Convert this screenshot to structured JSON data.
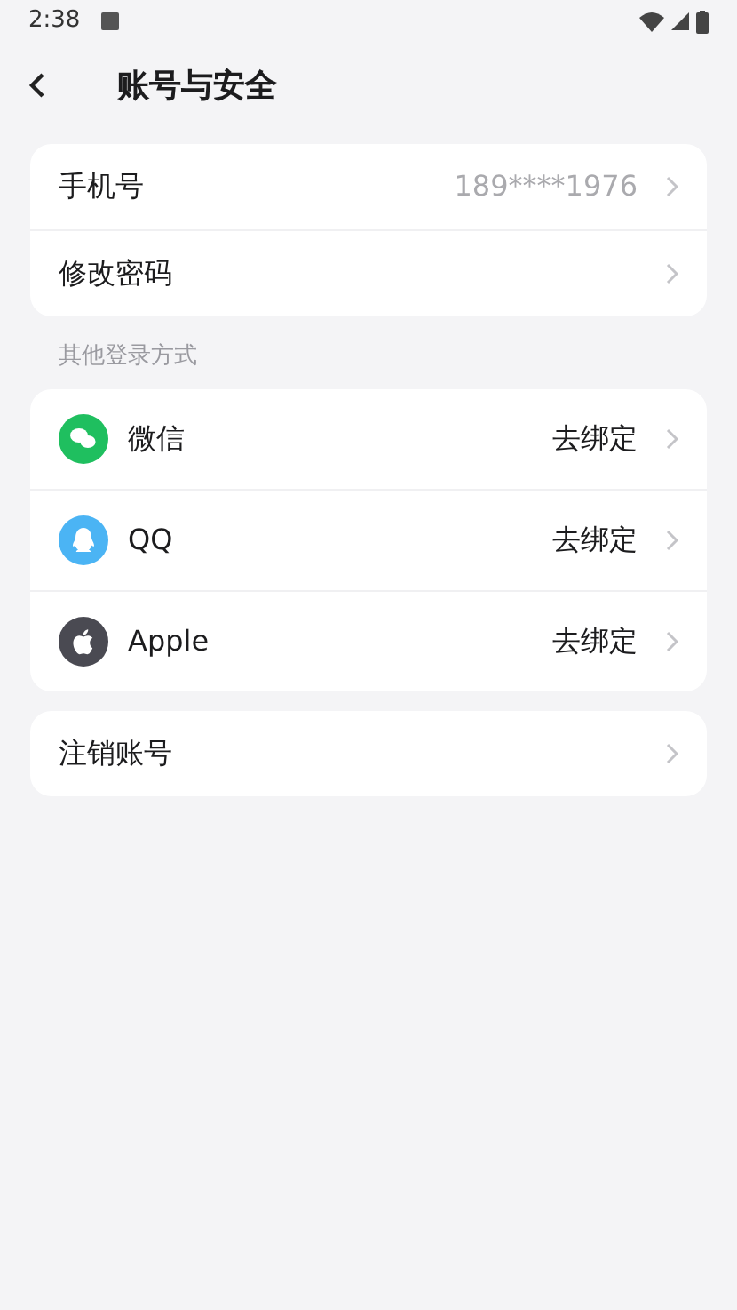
{
  "status_bar": {
    "time": "2:38"
  },
  "header": {
    "title": "账号与安全"
  },
  "account_items": [
    {
      "label": "手机号",
      "value": "189****1976"
    },
    {
      "label": "修改密码"
    }
  ],
  "section_label": "其他登录方式",
  "login_methods": [
    {
      "kind": "wechat",
      "color": "#1fbf5f",
      "label": "微信",
      "action": "去绑定"
    },
    {
      "kind": "qq",
      "color": "#4bb4f4",
      "label": "QQ",
      "action": "去绑定"
    },
    {
      "kind": "apple",
      "color": "#4a4a52",
      "label": "Apple",
      "action": "去绑定"
    }
  ],
  "danger_items": [
    {
      "label": "注销账号"
    }
  ]
}
